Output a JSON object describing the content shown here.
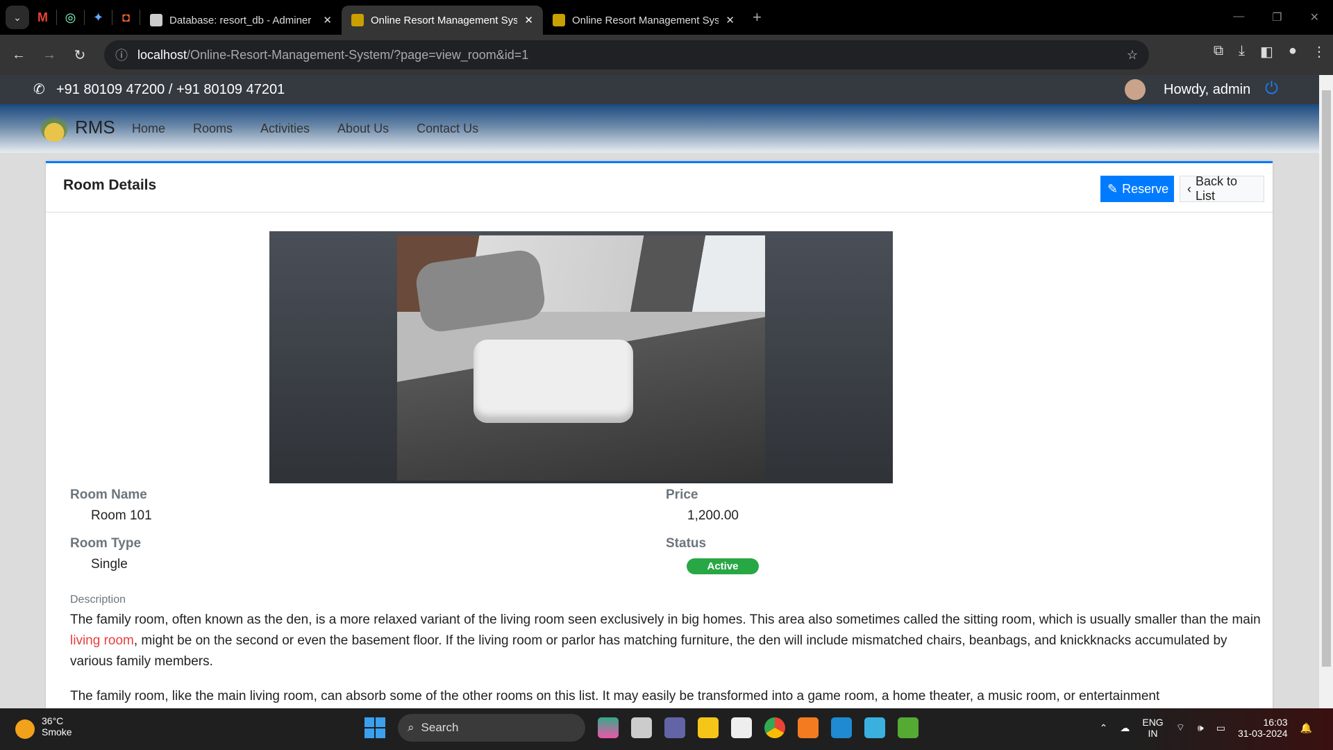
{
  "browser": {
    "tabs": [
      {
        "title": "Database: resort_db - Adminer"
      },
      {
        "title": "Online Resort Management System",
        "active": true
      },
      {
        "title": "Online Resort Management System"
      }
    ],
    "url_host": "localhost",
    "url_path": "/Online-Resort-Management-System/?page=view_room&id=1"
  },
  "topbar": {
    "phone": "+91 80109 47200 / +91 80109 47201",
    "greeting": "Howdy, admin"
  },
  "navbar": {
    "brand": "RMS",
    "items": [
      "Home",
      "Rooms",
      "Activities",
      "About Us",
      "Contact Us"
    ]
  },
  "card": {
    "title": "Room Details",
    "reserve_label": "Reserve",
    "back_label": "Back to List",
    "room_name_label": "Room Name",
    "room_name": "Room 101",
    "room_type_label": "Room Type",
    "room_type": "Single",
    "price_label": "Price",
    "price": "1,200.00",
    "status_label": "Status",
    "status": "Active",
    "description_label": "Description",
    "desc_p1_a": "The family room, often known as the den, is a more relaxed variant of the living room seen exclusively in big homes. This area also sometimes called the sitting room, which is usually smaller than the main ",
    "desc_p1_link": "living room",
    "desc_p1_b": ", might be on the second or even the basement floor. If the living room or parlor has matching furniture, the den will include mismatched chairs, beanbags, and knickknacks accumulated by various family members.",
    "desc_p2": "The family room, like the main living room, can absorb some of the other rooms on this list. It may easily be transformed into a game room, a home theater, a music room, or entertainment"
  },
  "taskbar": {
    "temp": "36°C",
    "weather": "Smoke",
    "search": "Search",
    "lang1": "ENG",
    "lang2": "IN",
    "time": "16:03",
    "date": "31-03-2024"
  },
  "colors": {
    "primary": "#007bff",
    "success": "#28a745",
    "topbar": "#343a40"
  }
}
